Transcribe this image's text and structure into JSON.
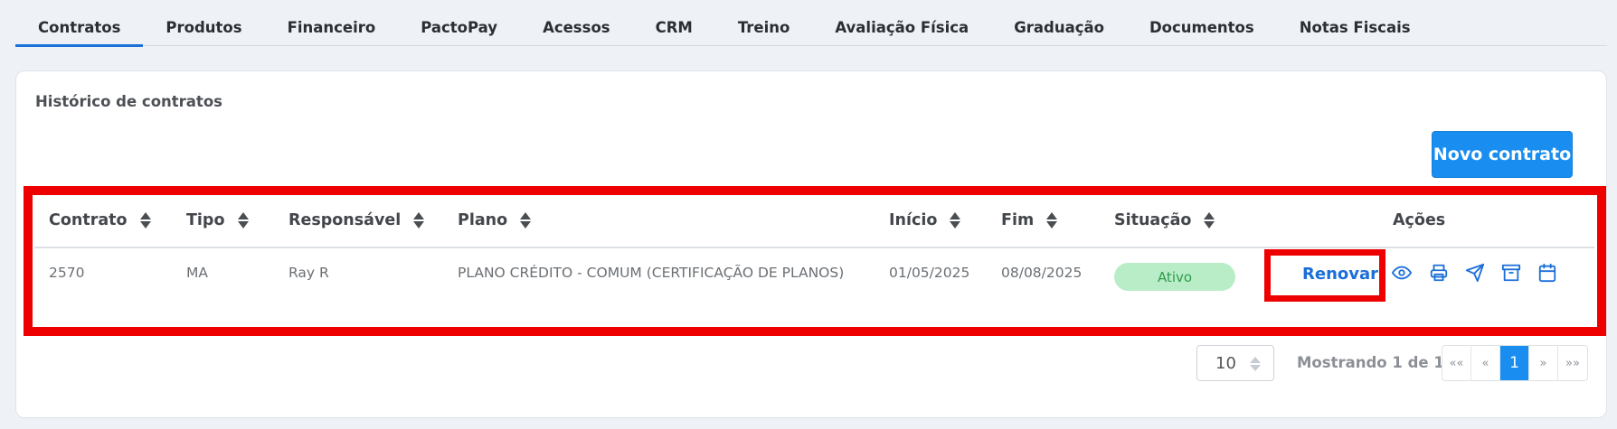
{
  "tabs": [
    {
      "label": "Contratos",
      "active": true
    },
    {
      "label": "Produtos"
    },
    {
      "label": "Financeiro"
    },
    {
      "label": "PactoPay"
    },
    {
      "label": "Acessos"
    },
    {
      "label": "CRM"
    },
    {
      "label": "Treino"
    },
    {
      "label": "Avaliação Física"
    },
    {
      "label": "Graduação"
    },
    {
      "label": "Documentos"
    },
    {
      "label": "Notas Fiscais"
    }
  ],
  "card": {
    "title": "Histórico de contratos",
    "new_button": "Novo contrato"
  },
  "table": {
    "columns": {
      "contrato": "Contrato",
      "tipo": "Tipo",
      "responsavel": "Responsável",
      "plano": "Plano",
      "inicio": "Início",
      "fim": "Fim",
      "situacao": "Situação",
      "acoes": "Ações"
    },
    "row": {
      "contrato": "2570",
      "tipo": "MA",
      "responsavel": "Ray R",
      "plano": "PLANO CRÉDITO - COMUM (CERTIFICAÇÃO DE PLANOS)",
      "inicio": "01/05/2025",
      "fim": "08/08/2025",
      "situacao": "Ativo",
      "renew_label": "Renovar",
      "action_icons": [
        "eye-icon",
        "print-icon",
        "send-icon",
        "archive-icon",
        "calendar-icon"
      ]
    }
  },
  "pagination": {
    "page_size": "10",
    "showing": "Mostrando 1 de 1",
    "first": "««",
    "prev": "«",
    "current": "1",
    "next": "»",
    "last": "»»"
  },
  "colors": {
    "accent": "#1a8ef0",
    "highlight": "#ee0000",
    "status_active_bg": "#b9edc7"
  }
}
